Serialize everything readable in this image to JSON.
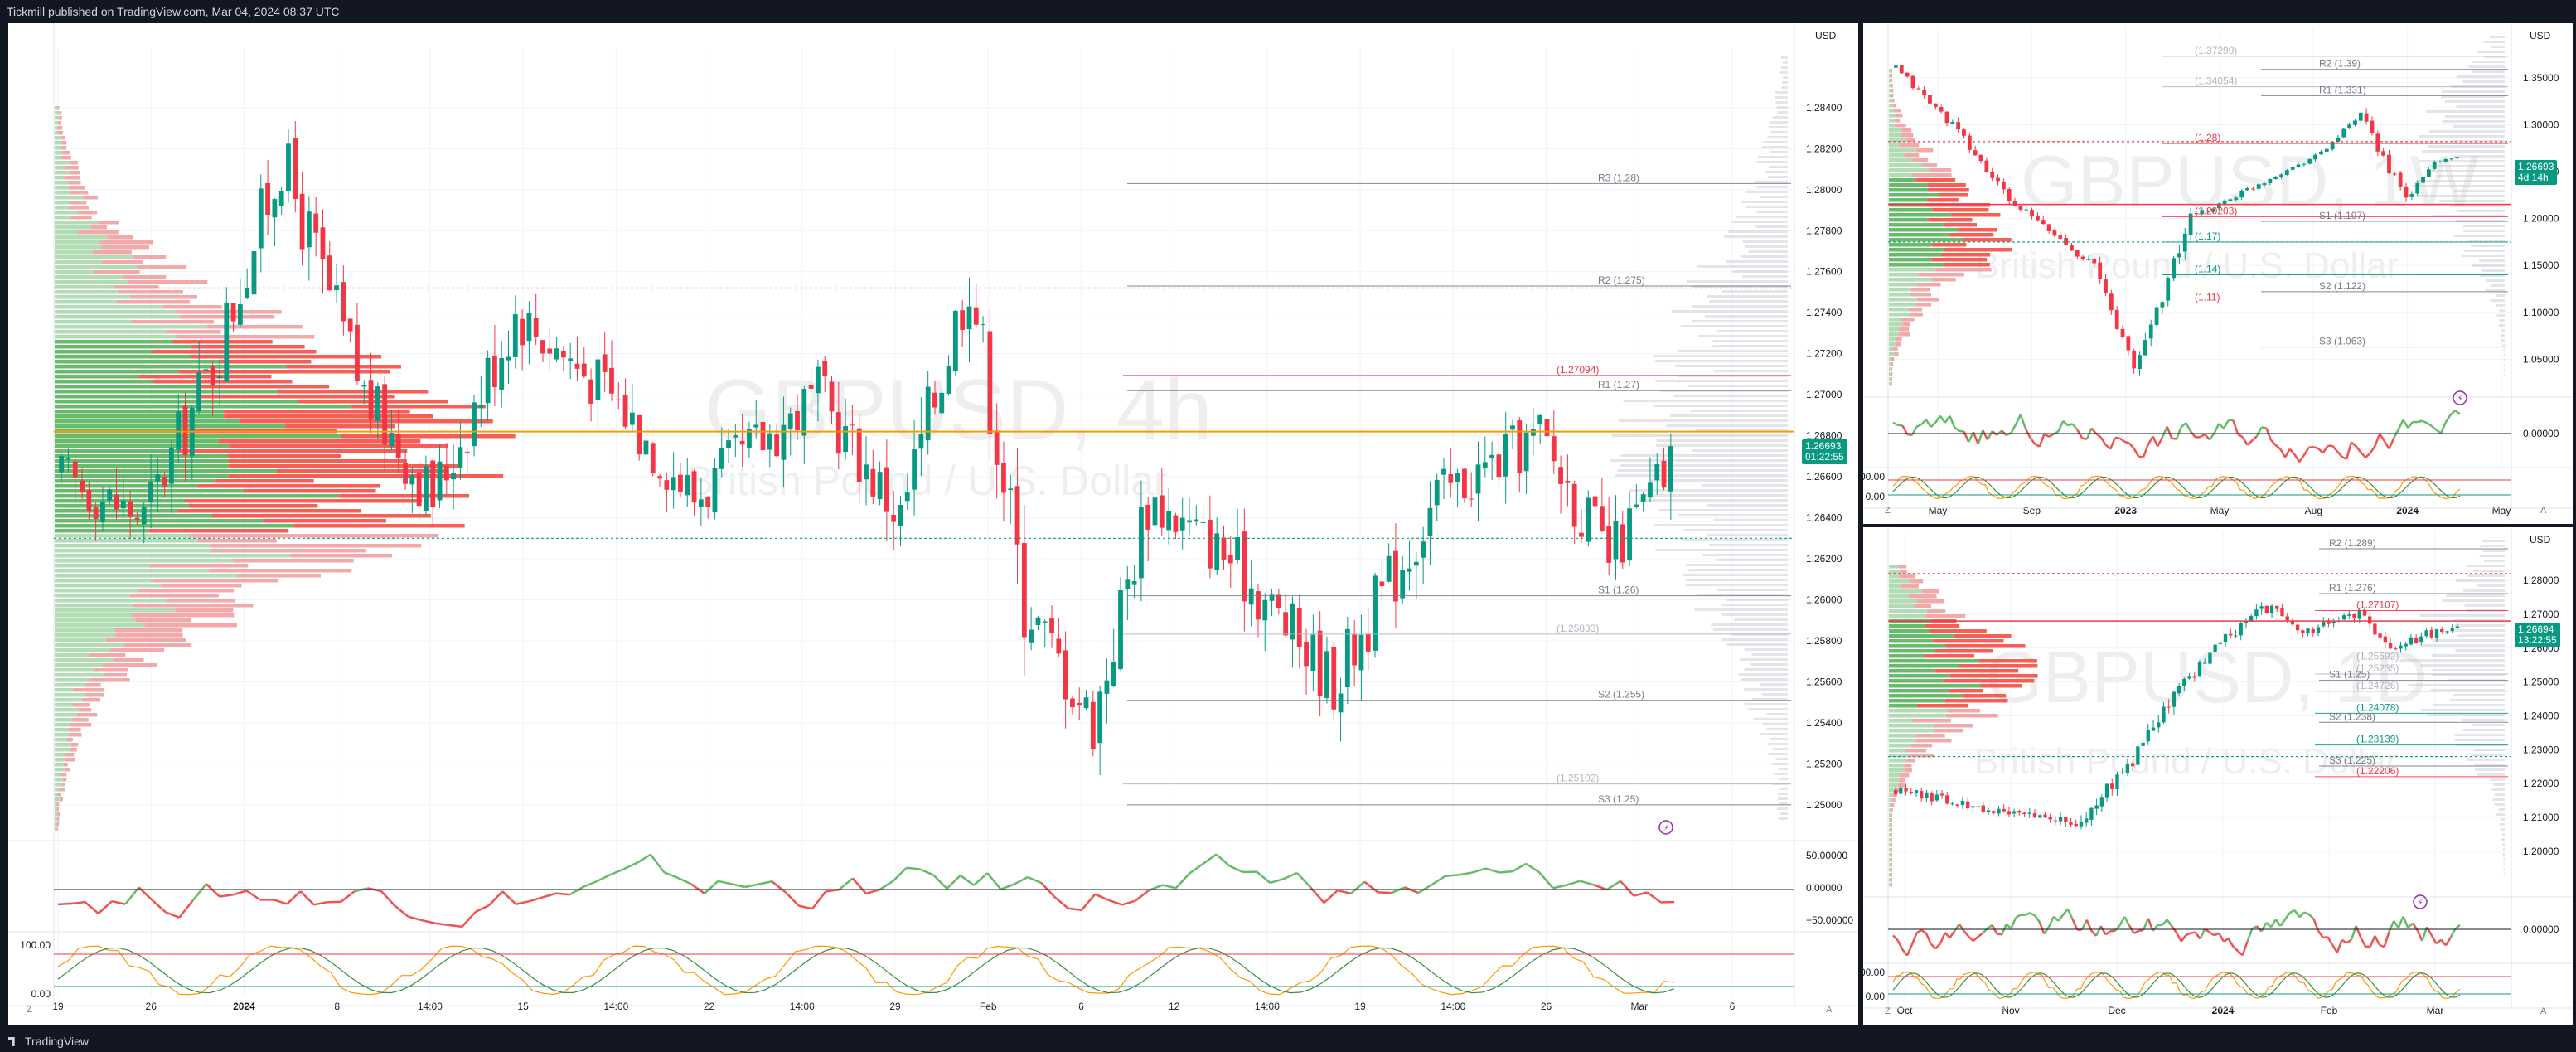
{
  "header": {
    "publish_text": "Tickmill published on TradingView.com, Mar 04, 2024 08:37 UTC"
  },
  "footer": {
    "brand": "TradingView"
  },
  "colors": {
    "up": "#089981",
    "down": "#f23645",
    "rsi_up": "#66bb6a",
    "rsi_down": "#ef5350",
    "orange": "#ff9800",
    "purple": "#9c27b0",
    "blue": "#2962ff"
  },
  "chart_data": [
    {
      "id": "main",
      "type": "candlestick",
      "symbol": "GBPUSD, 4h",
      "description": "British Pound / U.S. Dollar",
      "unit": "USD",
      "ylim": [
        1.2485,
        1.2865
      ],
      "y_ticks": [
        "1.28400",
        "1.28200",
        "1.28000",
        "1.27800",
        "1.27600",
        "1.27400",
        "1.27200",
        "1.27000",
        "1.26800",
        "1.26600",
        "1.26400",
        "1.26200",
        "1.26000",
        "1.25800",
        "1.25600",
        "1.25400",
        "1.25200",
        "1.25000"
      ],
      "x_ticks": [
        "19",
        "26",
        "2024",
        "8",
        "14:00",
        "15",
        "14:00",
        "22",
        "14:00",
        "29",
        "Feb",
        "6",
        "12",
        "14:00",
        "19",
        "14:00",
        "26",
        "Mar",
        "6"
      ],
      "last_price": "1.26693",
      "countdown": "01:22:55",
      "levels": [
        {
          "label": "R3 (1.28)",
          "value": 1.2803,
          "color": "#787b86"
        },
        {
          "label": "R2 (1.275)",
          "value": 1.2753,
          "color": "#787b86"
        },
        {
          "label": "R1 (1.27)",
          "value": 1.2702,
          "color": "#787b86"
        },
        {
          "label": "(1.27094)",
          "value": 1.27094,
          "color": "#f23645"
        },
        {
          "label": "S1 (1.26)",
          "value": 1.2602,
          "color": "#787b86"
        },
        {
          "label": "(1.25833)",
          "value": 1.25833,
          "color": "#b2b5be"
        },
        {
          "label": "S2 (1.255)",
          "value": 1.2551,
          "color": "#787b86"
        },
        {
          "label": "(1.25102)",
          "value": 1.25102,
          "color": "#b2b5be"
        },
        {
          "label": "S3 (1.25)",
          "value": 1.25,
          "color": "#787b86"
        }
      ],
      "rsi": {
        "ticks": [
          "50.00000",
          "0.00000",
          "−50.00000"
        ],
        "last": 0.2
      },
      "stoch": {
        "ticks": [
          "100.00",
          "0.00"
        ]
      }
    },
    {
      "id": "weekly",
      "type": "candlestick",
      "symbol": "GBPUSD, 1W",
      "description": "British Pound / U.S. Dollar",
      "unit": "USD",
      "ylim": [
        1.015,
        1.395
      ],
      "y_ticks": [
        "1.35000",
        "1.30000",
        "1.25000",
        "1.20000",
        "1.15000",
        "1.10000",
        "1.05000"
      ],
      "x_ticks": [
        "May",
        "Sep",
        "2023",
        "May",
        "Aug",
        "2024",
        "May"
      ],
      "last_price": "1.26693",
      "countdown": "4d 14h",
      "levels": [
        {
          "label": "(1.37299)",
          "value": 1.373,
          "color": "#b2b5be"
        },
        {
          "label": "R2 (1.39)",
          "value": 1.359,
          "color": "#787b86"
        },
        {
          "label": "(1.34054)",
          "value": 1.3405,
          "color": "#b2b5be"
        },
        {
          "label": "R1 (1.331)",
          "value": 1.331,
          "color": "#787b86"
        },
        {
          "label": "(1.28)",
          "value": 1.28,
          "color": "#f23645"
        },
        {
          "label": "(1.20203)",
          "value": 1.202,
          "color": "#f23645"
        },
        {
          "label": "S1 (1.197)",
          "value": 1.197,
          "color": "#787b86"
        },
        {
          "label": "(1.17)",
          "value": 1.175,
          "color": "#089981"
        },
        {
          "label": "(1.14)",
          "value": 1.14,
          "color": "#089981"
        },
        {
          "label": "S2 (1.122)",
          "value": 1.122,
          "color": "#787b86"
        },
        {
          "label": "(1.11)",
          "value": 1.11,
          "color": "#f23645"
        },
        {
          "label": "S3 (1.063)",
          "value": 1.063,
          "color": "#787b86"
        }
      ],
      "rsi": {
        "ticks": [
          "0.00000"
        ]
      },
      "stoch": {
        "ticks": [
          "100.00",
          "0.00"
        ]
      }
    },
    {
      "id": "daily",
      "type": "candlestick",
      "symbol": "GBPUSD, 1D",
      "description": "British Pound / U.S. Dollar",
      "unit": "USD",
      "ylim": [
        1.188,
        1.292
      ],
      "y_ticks": [
        "1.28000",
        "1.27000",
        "1.26000",
        "1.25000",
        "1.24000",
        "1.23000",
        "1.22000",
        "1.21000",
        "1.20000"
      ],
      "x_ticks": [
        "Oct",
        "Nov",
        "Dec",
        "2024",
        "Feb",
        "Mar"
      ],
      "last_price": "1.26694",
      "countdown": "13:22:55",
      "levels": [
        {
          "label": "R2 (1.289)",
          "value": 1.2893,
          "color": "#787b86"
        },
        {
          "label": "R1 (1.276)",
          "value": 1.2761,
          "color": "#787b86"
        },
        {
          "label": "(1.27107)",
          "value": 1.27107,
          "color": "#f23645"
        },
        {
          "label": "(1.25592)",
          "value": 1.25592,
          "color": "#b2b5be"
        },
        {
          "label": "(1.25235)",
          "value": 1.25235,
          "color": "#b2b5be"
        },
        {
          "label": "S1 (1.25)",
          "value": 1.2505,
          "color": "#787b86"
        },
        {
          "label": "(1.24726)",
          "value": 1.24726,
          "color": "#b2b5be"
        },
        {
          "label": "(1.24078)",
          "value": 1.24078,
          "color": "#089981"
        },
        {
          "label": "S2 (1.238)",
          "value": 1.2381,
          "color": "#787b86"
        },
        {
          "label": "(1.23139)",
          "value": 1.23139,
          "color": "#089981"
        },
        {
          "label": "S3 (1.225)",
          "value": 1.2252,
          "color": "#787b86"
        },
        {
          "label": "(1.22206)",
          "value": 1.22206,
          "color": "#f23645"
        }
      ],
      "rsi": {
        "ticks": [
          "0.00000"
        ]
      },
      "stoch": {
        "ticks": [
          "100.00",
          "0.00"
        ]
      }
    }
  ]
}
